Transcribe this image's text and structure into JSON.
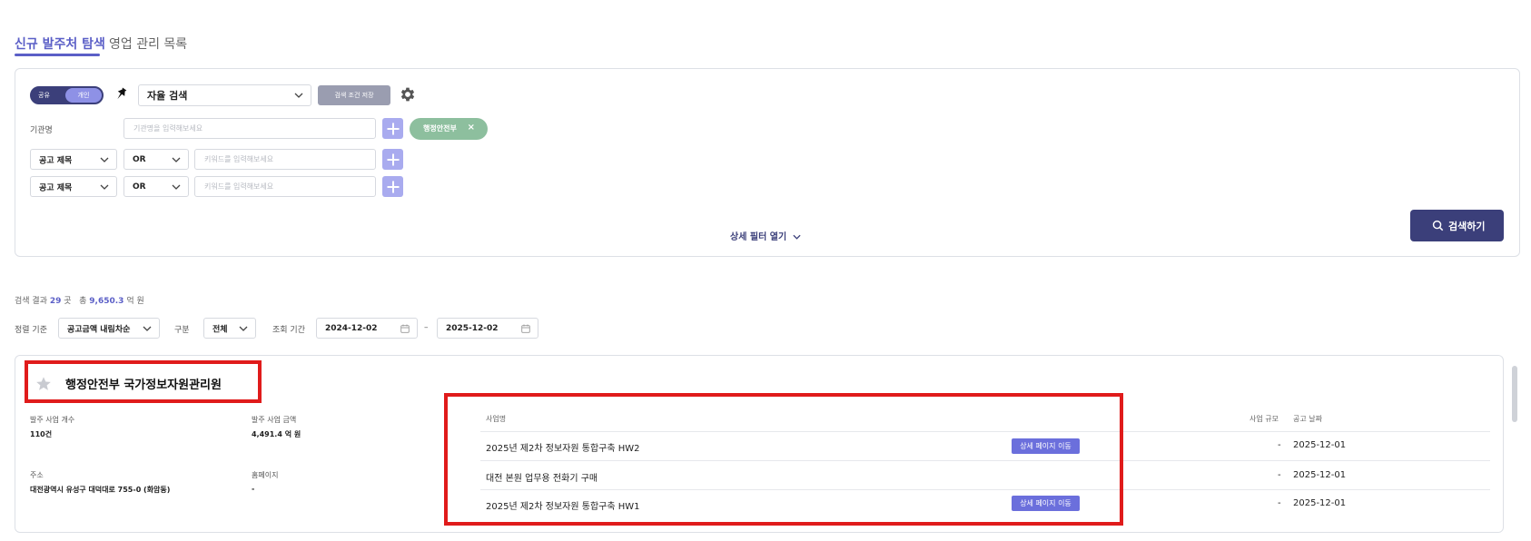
{
  "tabs": {
    "active": "신규 발주처 탐색",
    "inactive": "영업 관리 목록"
  },
  "search_panel": {
    "toggle": {
      "left": "공유",
      "right": "개인"
    },
    "mode_select": "자율 검색",
    "save_condition": "검색 조건 저장",
    "org_label": "기관명",
    "org_placeholder": "기관명을 입력해보세요",
    "chip": {
      "label": "행정안전부",
      "remove": "×"
    },
    "rows": [
      {
        "field": "공고 제목",
        "op": "OR",
        "placeholder": "키워드를 입력해보세요"
      },
      {
        "field": "공고 제목",
        "op": "OR",
        "placeholder": "키워드를 입력해보세요"
      }
    ],
    "detail_filter": "상세 필터 열기",
    "search_button": "검색하기"
  },
  "summary": {
    "prefix": "검색 결과",
    "count": "29",
    "count_unit": "곳",
    "total_prefix": "총",
    "total": "9,650.3",
    "total_unit": "억 원"
  },
  "filters": {
    "sort_label": "정렬 기준",
    "sort_value": "공고금액 내림차순",
    "category_label": "구분",
    "category_value": "전체",
    "period_label": "조회 기간",
    "date_from": "2024-12-02",
    "date_sep": "–",
    "date_to": "2025-12-02"
  },
  "result": {
    "title": "행정안전부 국가정보자원관리원",
    "projects_label": "발주 사업 개수",
    "projects_value": "110건",
    "amount_label": "발주 사업 금액",
    "amount_value": "4,491.4 억 원",
    "address_label": "주소",
    "address_value": "대전광역시 유성구 대덕대로 755-0 (화암동)",
    "homepage_label": "홈페이지",
    "homepage_value": "-",
    "table": {
      "headers": {
        "name": "사업명",
        "scale": "사업 규모",
        "date": "공고 날짜"
      },
      "rows": [
        {
          "name": "2025년 제2차 정보자원 통합구축 HW2",
          "button": "상세 페이지 이동",
          "scale": "-",
          "date": "2025-12-01"
        },
        {
          "name": "대전 본원 업무용 전화기 구매",
          "button": "",
          "scale": "-",
          "date": "2025-12-01"
        },
        {
          "name": "2025년 제2차 정보자원 통합구축 HW1",
          "button": "상세 페이지 이동",
          "scale": "-",
          "date": "2025-12-01"
        }
      ]
    }
  },
  "colors": {
    "accent": "#5b5fc7",
    "navy": "#3b3f7a",
    "chip": "#8dbf9e",
    "highlight": "#e01b1b"
  }
}
